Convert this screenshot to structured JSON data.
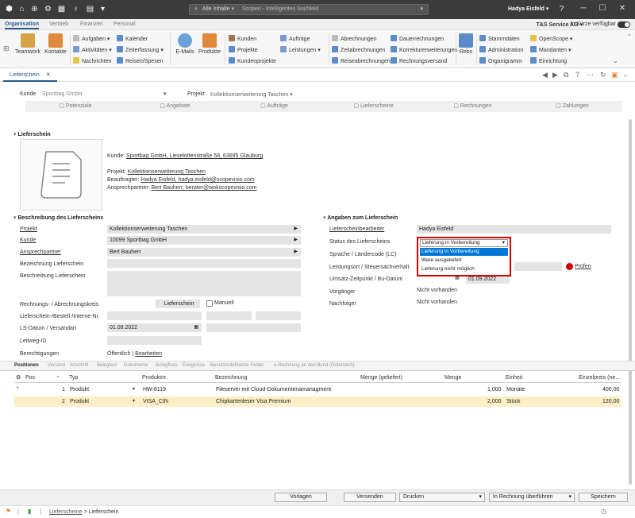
{
  "search": {
    "scope": "Alle Inhalte",
    "text": "Scopen - Intelligentes Suchfeld"
  },
  "user": {
    "name": "Hadya Eisfeld ▾"
  },
  "menu_tabs": [
    "Organisation",
    "Vertrieb",
    "Finanzen",
    "Personal"
  ],
  "company": "T&S Service AG ▾",
  "availability": "In Kürze verfügbar",
  "ribbon": {
    "teamwork": "Teamwork",
    "kontakte": "Kontakte",
    "emails": "E-Mails",
    "produkte": "Produkte",
    "rebs": "Rebs",
    "aufgaben": "Aufgaben ▾",
    "kalender": "Kalender",
    "aktivitaeten": "Aktivitäten ▾",
    "zeiterfassung": "Zeiterfassung ▾",
    "nachrichten": "Nachrichten",
    "reisen": "Reisen/Spesen",
    "kunden": "Kunden",
    "projekte": "Projekte",
    "kundenprojekte": "Kundenprojekte",
    "auftraege": "Aufträge",
    "leistungen": "Leistungen ▾",
    "abrechnungen": "Abrechnungen",
    "zeitabrechnungen": "Zeitabrechnungen",
    "reiseabrechnungen": "Reiseabrechnungen",
    "dauerrechnungen": "Dauerrechnungen",
    "korrektur": "Korrekturerweiterungen",
    "rechnungsversand": "Rechnungsversand",
    "stammdaten": "Stammdaten",
    "administration": "Administration",
    "organigramm": "Organigramm",
    "openscope": "OpenScope ▾",
    "mandanten": "Mandanten ▾",
    "einrichtung": "Einrichtung"
  },
  "doc_tab": "Lieferschein",
  "header": {
    "kunde_label": "Kunde",
    "kunde_value": "Sportbag GmbH",
    "projekt_label": "Projekt",
    "projekt_value": "Kollektionserweiterung Taschen ▾"
  },
  "steps": [
    "Potenziale",
    "Angebote",
    "Aufträge",
    "Lieferscheine",
    "Rechnungen",
    "Zahlungen"
  ],
  "section_lieferschein": "Lieferschein",
  "info": {
    "kunde_prefix": "Kunde:",
    "kunde_link": "Sportbag GmbH, Lieselottenstraße 58, 63695 Glauburg",
    "projekt_prefix": "Projekt:",
    "projekt_link": "Kollektionserweiterung Taschen",
    "beauftragter_prefix": "Beauftragter:",
    "beauftragter_link": "Hadya Eisfeld, hadya.eisfeld@scopevisio.com",
    "ansprech_prefix": "Ansprechpartner:",
    "ansprech_link": "Bert Bauherr, berater@wokscopevisio.com"
  },
  "section_beschreibung": "Beschreibung des Lieferscheins",
  "left_form": {
    "projekt_l": "Projekt",
    "projekt_v": "Kollektionserweiterung Taschen",
    "kunde_l": "Kunde",
    "kunde_v": "10099 Sportbag GmbH",
    "ansprech_l": "Ansprechpartner",
    "ansprech_v": "Bert Bauherr",
    "bez_l": "Bezeichnung Lieferschein",
    "beschr_l": "Beschreibung Lieferschein",
    "kreis_l": "Rechnungs- / Abrechnungskreis",
    "kreis_v": "Lieferschein",
    "manuell": "Manuell",
    "nr_l": "Lieferschein-/Bestell-/Interne-Nr.",
    "datum_l": "LS-Datum / Versandart",
    "datum_v": "01.09.2022",
    "leitweg_l": "Leitweg-ID",
    "berecht_l": "Berechtigungen",
    "berecht_v": "Öffentlich |",
    "berecht_link": "Bearbeiten"
  },
  "section_angaben": "Angaben zum Lieferschein",
  "right_form": {
    "bearb_l": "Lieferscheinbearbeiter",
    "bearb_v": "Hadya Eisfeld",
    "status_l": "Status des Lieferscheins",
    "sprache_l": "Sprache / Ländercode (LC)",
    "ort_l": "Leistungsort / Steuersachverhalt",
    "pruefen": "Prüfen",
    "umsatz_l": "Umsatz-Zeitpunkt / Bu-Datum",
    "umsatz_v": "01.09.2022",
    "vorg_l": "Vorgänger",
    "vorg_v": "Nicht vorhanden",
    "nachf_l": "Nachfolger",
    "nachf_v": "Nicht vorhanden"
  },
  "status_dropdown": {
    "current": "Lieferung in Vorbereitung",
    "options": [
      "Lieferung in Vorbereitung",
      "Ware ausgeliefert",
      "Lieferung nicht möglich"
    ]
  },
  "pos_tabs": [
    "Positionen",
    "Versand",
    "Anschrift",
    "Belegtext",
    "Dokumente",
    "Belegfluss",
    "Ereignisse",
    "Benutzerdefinierte Felder",
    "e-Rechnung an den Bund (Österreich)"
  ],
  "table": {
    "headers": [
      "Pos",
      "Typ",
      "Produktnr.",
      "Bezeichnung",
      "Menge (geliefert)",
      "Menge",
      "Einheit",
      "Einzelpreis (ne..."
    ],
    "rows": [
      [
        "1",
        "Produkt",
        "HW-8119",
        "Fileserver mit Cloud-Dokumentenamanagment",
        "",
        "1,000",
        "Monate",
        "400,00"
      ],
      [
        "2",
        "Produkt",
        "VISA_CIN",
        "Chipkartenleser Visa Premium",
        "",
        "2,000",
        "Stück",
        "120,00"
      ]
    ]
  },
  "bottom_buttons": {
    "vorlagen": "Vorlagen",
    "versenden": "Versenden",
    "drucken": "Drucken",
    "rechnung": "In Rechnung überführen",
    "speichern": "Speichern"
  },
  "breadcrumb": {
    "parent": "Lieferscheine",
    "sep": ">",
    "current": "Lieferschein"
  },
  "colors": {
    "accent": "#2a5d8f",
    "highlight_red": "#d00000",
    "row_selected": "#fcefc7"
  }
}
